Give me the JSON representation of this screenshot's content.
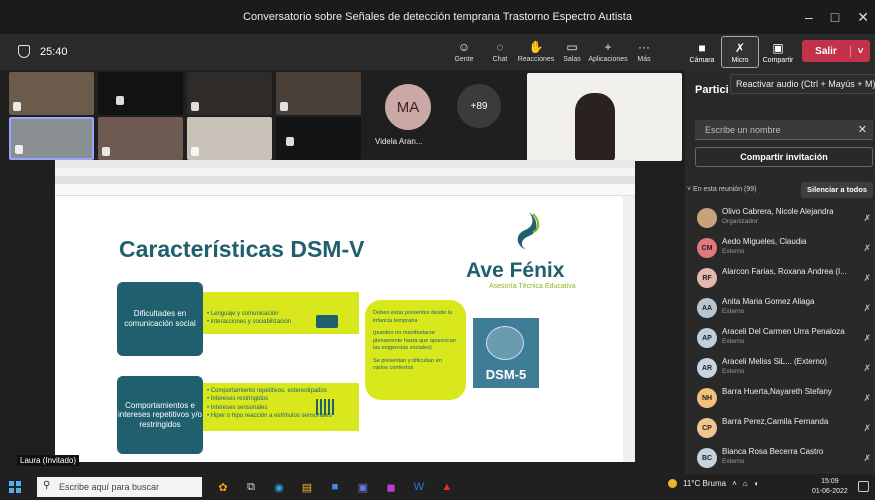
{
  "window": {
    "title": "Conversatorio sobre Señales de detección temprana Trastorno Espectro Autista",
    "minimize": "–",
    "maximize": "□",
    "close": "✕"
  },
  "meeting": {
    "timer": "25:40"
  },
  "toolbar": {
    "gente": "Gente",
    "chat": "Chat",
    "reacciones": "Reacciones",
    "salas": "Salas",
    "aplicaciones": "Aplicaciones",
    "mas": "Más",
    "camara": "Cámara",
    "micro": "Micro",
    "compartir": "Compartir",
    "salir": "Salir"
  },
  "tooltip": "Reactivar audio (Ctrl + Mayús + M)",
  "videos": {
    "ma_initials": "MA",
    "ma_name": "Videla Aran...",
    "more_count": "+89"
  },
  "presenter_label": "Laura (Invitado)",
  "slide": {
    "title": "Características DSM-V",
    "logo_name": "Ave Fénix",
    "logo_sub": "Asesoría Técnica Educativa",
    "box1": "Dificultades en comunicación social",
    "box1_items": [
      "• Lenguaje y comunicación",
      "• interacciones y sociabilización"
    ],
    "box2": "Comportamientos e intereses repetitivos y/o restringidos",
    "box2_items": [
      "• Comportamiento repetitivos, estereotipados",
      "• Intereses restringidos",
      "• Intereses sensoriales",
      "• Hiper o hipo reacción a estímulos sensoriales"
    ],
    "note1": "Deben estar presentes desde la infancia temprana",
    "note2": "(pueden no manifestarse plenamente hasta que aparezcan las exigencias sociales)",
    "note3": "Se presentan y dificultan en varios contextos",
    "dsm_label": "DSM-5"
  },
  "panel": {
    "title": "Partici",
    "search_placeholder": "Escribe un nombre",
    "invite": "Compartir invitación",
    "section": "˅ En esta reunión (99)",
    "silence_all": "Silenciar a todos",
    "participants": [
      {
        "initials": "",
        "name": "Olivo Cabrera, Nicole Alejandra",
        "role": "Organizador",
        "color": "#c8a27a"
      },
      {
        "initials": "CM",
        "name": "Aedo Migueles, Claudia",
        "role": "Externo",
        "color": "#e3777e"
      },
      {
        "initials": "RF",
        "name": "Alarcon Farias, Roxana Andrea (I...",
        "role": "",
        "color": "#e6b8ad"
      },
      {
        "initials": "AA",
        "name": "Anita Maria Gomez Aliaga",
        "role": "Externo",
        "color": "#b7c6d3"
      },
      {
        "initials": "AP",
        "name": "Araceli Del Carmen Urra Penaloza",
        "role": "Externo",
        "color": "#c0cfdc"
      },
      {
        "initials": "AR",
        "name": "Araceli Meliss SiL... (Externo)",
        "role": "Externo",
        "color": "#c7d4e0"
      },
      {
        "initials": "NH",
        "name": "Barra Huerta,Nayareth Stefany",
        "role": "",
        "color": "#f0c17b"
      },
      {
        "initials": "CP",
        "name": "Barra Perez,Camila Fernanda",
        "role": "",
        "color": "#f1c58d"
      },
      {
        "initials": "BC",
        "name": "Bianca Rosa Becerra Castro",
        "role": "Externo",
        "color": "#c5d2df"
      }
    ]
  },
  "taskbar": {
    "search_placeholder": "Escribe aquí para buscar",
    "weather": "11°C Bruma",
    "time": "15:09",
    "date": "01-06-2022"
  },
  "colors": {
    "teal": "#1f5f6e",
    "lime": "#d8e81c",
    "leave": "#c4314b"
  }
}
